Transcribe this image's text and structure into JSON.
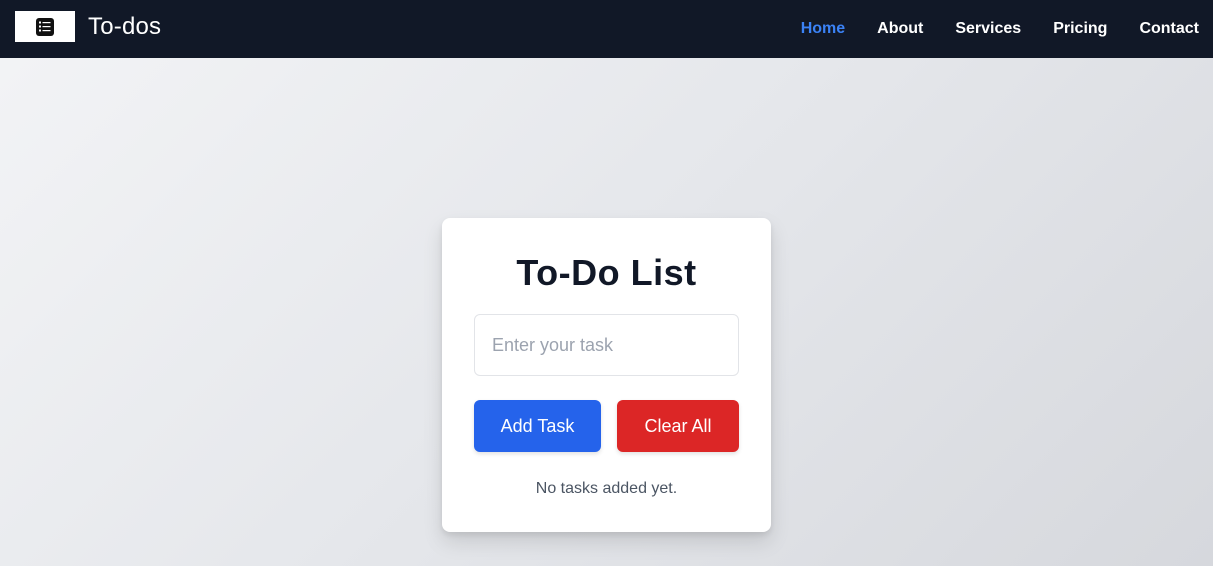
{
  "navbar": {
    "brand": "To-dos",
    "logo_icon": "checklist-icon",
    "links": [
      {
        "label": "Home",
        "active": true
      },
      {
        "label": "About",
        "active": false
      },
      {
        "label": "Services",
        "active": false
      },
      {
        "label": "Pricing",
        "active": false
      },
      {
        "label": "Contact",
        "active": false
      }
    ]
  },
  "card": {
    "title": "To-Do List",
    "input": {
      "placeholder": "Enter your task",
      "value": ""
    },
    "add_button_label": "Add Task",
    "clear_button_label": "Clear All",
    "empty_message": "No tasks added yet."
  },
  "colors": {
    "navbar_bg": "#111827",
    "nav_active": "#3b82f6",
    "add_button": "#2563eb",
    "clear_button": "#dc2626"
  }
}
